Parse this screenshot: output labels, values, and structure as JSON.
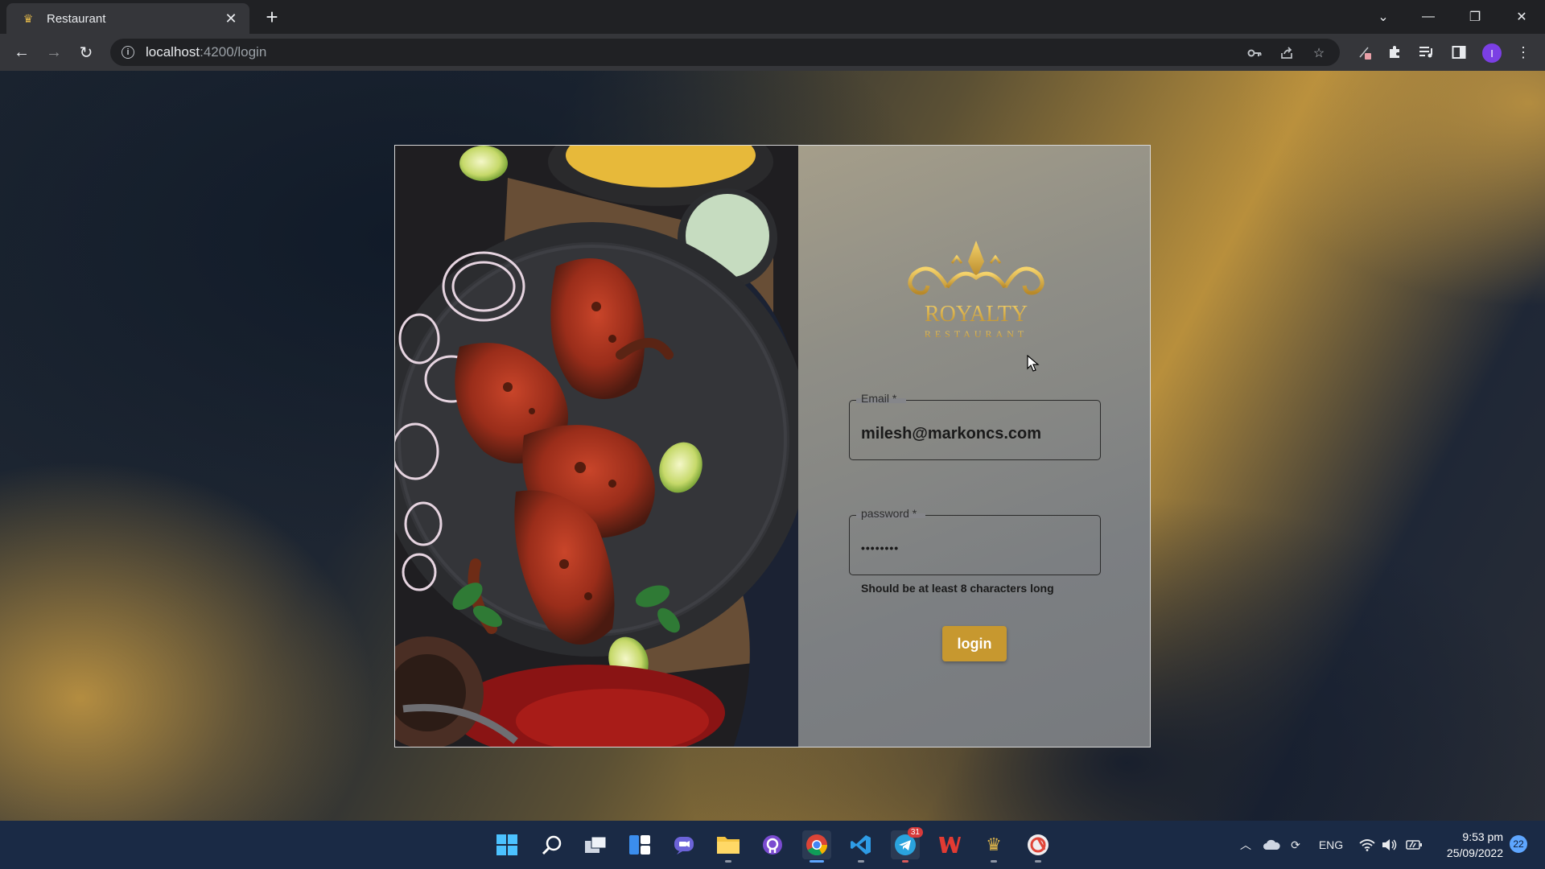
{
  "browser": {
    "tab_title": "Restaurant",
    "url_host": "localhost",
    "url_path": ":4200/login",
    "icons": [
      "restaurant-favicon",
      "close-icon",
      "plus-icon",
      "back-icon",
      "forward-icon",
      "reload-icon",
      "info-icon",
      "key-icon",
      "share-icon",
      "star-icon",
      "extension-icon",
      "puzzle-icon",
      "media-icon",
      "sidepanel-icon",
      "menu-icon"
    ],
    "profile_initial": "I",
    "window_controls": {
      "minimize": "—",
      "restore": "❐",
      "close": "✕"
    }
  },
  "login": {
    "logo_title": "ROYALTY",
    "logo_subtitle": "RESTAURANT",
    "email_label": "Email *",
    "email_value": "milesh@markoncs.com",
    "password_label": "password *",
    "password_value": "••••••••",
    "password_hint": "Should be at least 8 characters long",
    "login_button": "login"
  },
  "colors": {
    "accent": "#c7982f",
    "panel": "#85868a",
    "taskbar": "#1a2a45"
  },
  "taskbar": {
    "apps": [
      "start-icon",
      "search-icon",
      "task-view-icon",
      "widgets-icon",
      "chat-icon",
      "file-explorer-icon",
      "github-icon",
      "chrome-icon",
      "vscode-icon",
      "telegram-icon",
      "wps-icon",
      "crown-icon",
      "app-icon"
    ],
    "telegram_badge": "31",
    "language": "ENG",
    "time": "9:53 pm",
    "date": "25/09/2022",
    "notifications": "22"
  }
}
